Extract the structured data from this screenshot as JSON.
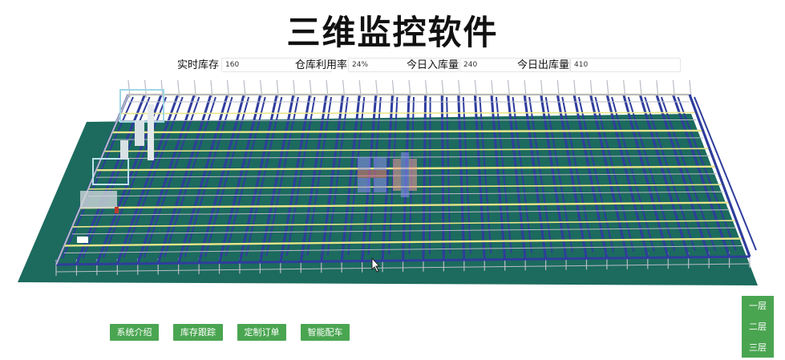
{
  "title": "三维监控软件",
  "stats": [
    {
      "label": "实时库存",
      "value": "160"
    },
    {
      "label": "仓库利用率",
      "value": "24%"
    },
    {
      "label": "今日入库量",
      "value": "240"
    },
    {
      "label": "今日出库量",
      "value": "410"
    }
  ],
  "buttons": [
    "系统介绍",
    "库存跟踪",
    "定制订单",
    "智能配车"
  ],
  "floors": [
    "一层",
    "二层",
    "三层"
  ],
  "colors": {
    "floor": "#1c6b5e",
    "rack_blue": "#2f3d9c",
    "rail_yellow": "#e7e58a",
    "beam_grey": "#b9bcc4",
    "button_green": "#4aa551"
  }
}
